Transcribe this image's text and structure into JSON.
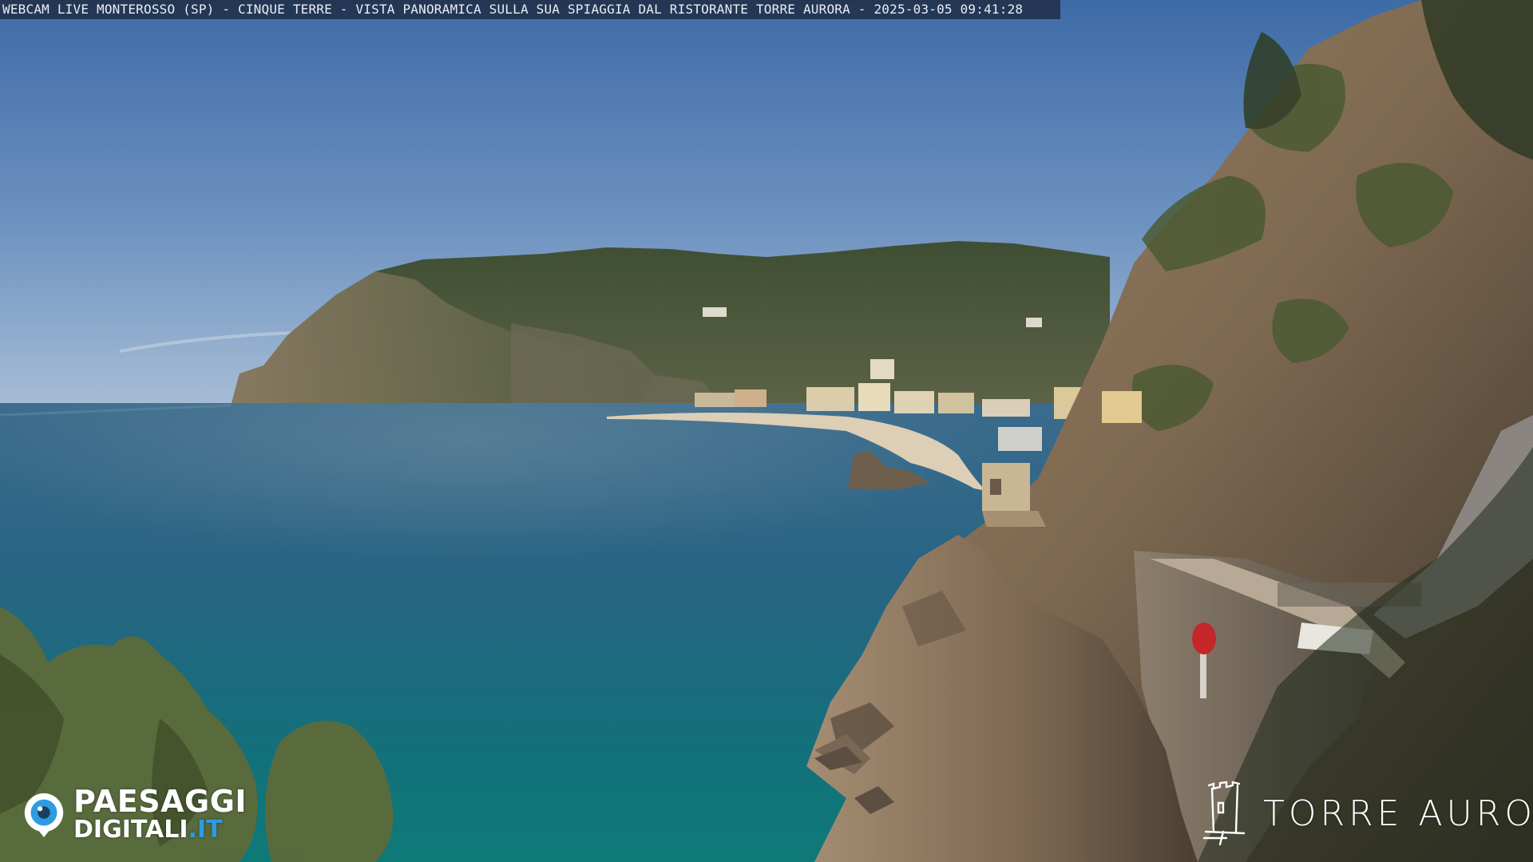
{
  "overlay": {
    "title": "WEBCAM LIVE MONTEROSSO (SP) - CINQUE TERRE - VISTA PANORAMICA SULLA SUA SPIAGGIA DAL RISTORANTE TORRE AURORA - 2025-03-05 09:41:28"
  },
  "watermark_left": {
    "line1": "PAESAGGI",
    "line2": "DIGITALI",
    "tld": ".IT",
    "icon": "camera-eye-icon",
    "accent_color": "#2f9be0"
  },
  "watermark_right": {
    "text": "TORRE AURORA",
    "icon": "tower-icon"
  },
  "scene": {
    "colors": {
      "sky_top": "#3f6fa8",
      "sky_horizon": "#9fb8d2",
      "sea_far": "#2d5f80",
      "sea_near": "#0f6b6c",
      "hills": "#4a5a3c",
      "cliff_rock": "#8a7156",
      "beach": "#d9cdb3"
    }
  }
}
